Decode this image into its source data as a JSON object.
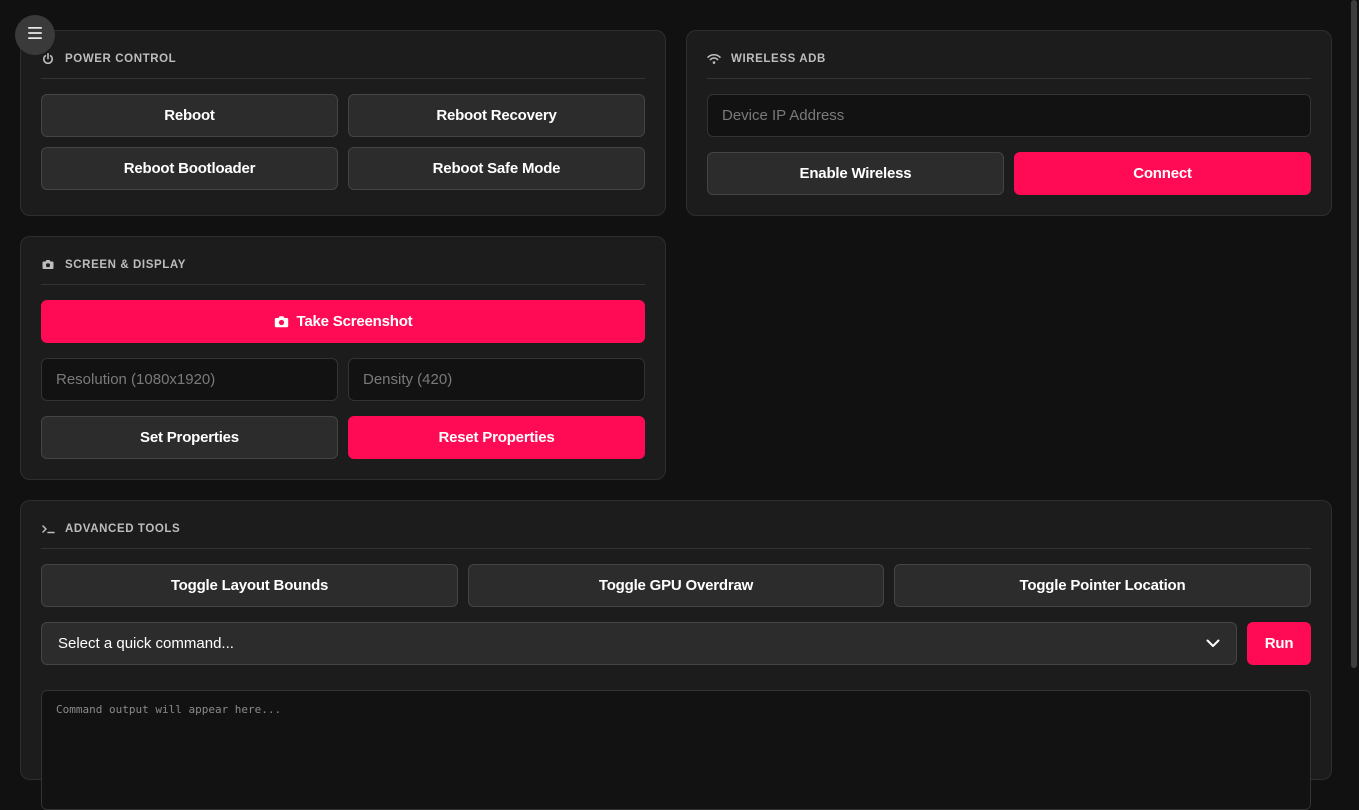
{
  "power": {
    "title": "Power Control",
    "reboot": "Reboot",
    "reboot_recovery": "Reboot Recovery",
    "reboot_bootloader": "Reboot Bootloader",
    "reboot_safe_mode": "Reboot Safe Mode"
  },
  "wireless": {
    "title": "Wireless ADB",
    "ip_placeholder": "Device IP Address",
    "enable": "Enable Wireless",
    "connect": "Connect"
  },
  "screen": {
    "title": "Screen & Display",
    "take_screenshot": "Take Screenshot",
    "resolution_placeholder": "Resolution (1080x1920)",
    "density_placeholder": "Density (420)",
    "set_properties": "Set Properties",
    "reset_properties": "Reset Properties"
  },
  "advanced": {
    "title": "Advanced Tools",
    "toggle_layout_bounds": "Toggle Layout Bounds",
    "toggle_gpu_overdraw": "Toggle GPU Overdraw",
    "toggle_pointer_location": "Toggle Pointer Location",
    "quick_command_selected": "Select a quick command...",
    "run": "Run",
    "output_placeholder": "Command output will appear here..."
  },
  "icons": {
    "menu": "hamburger-menu-icon",
    "power": "power-icon",
    "wifi": "wifi-icon",
    "camera": "camera-icon",
    "terminal": "terminal-icon",
    "chevron": "chevron-down-icon"
  },
  "colors": {
    "accent": "#ff0a54",
    "background": "#111111",
    "card": "#1c1c1c",
    "button_dark": "#2c2c2c"
  }
}
